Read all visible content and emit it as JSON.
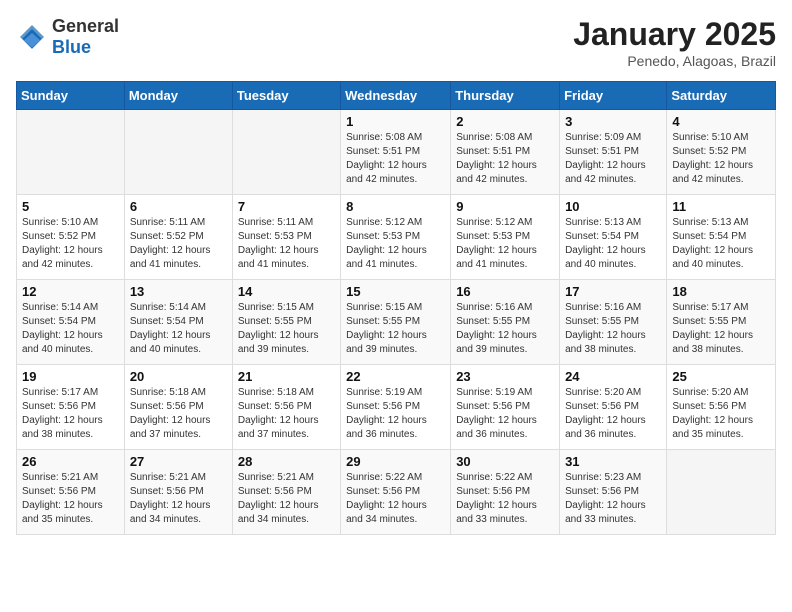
{
  "logo": {
    "general": "General",
    "blue": "Blue"
  },
  "title": "January 2025",
  "subtitle": "Penedo, Alagoas, Brazil",
  "days_of_week": [
    "Sunday",
    "Monday",
    "Tuesday",
    "Wednesday",
    "Thursday",
    "Friday",
    "Saturday"
  ],
  "weeks": [
    [
      {
        "day": "",
        "info": ""
      },
      {
        "day": "",
        "info": ""
      },
      {
        "day": "",
        "info": ""
      },
      {
        "day": "1",
        "info": "Sunrise: 5:08 AM\nSunset: 5:51 PM\nDaylight: 12 hours and 42 minutes."
      },
      {
        "day": "2",
        "info": "Sunrise: 5:08 AM\nSunset: 5:51 PM\nDaylight: 12 hours and 42 minutes."
      },
      {
        "day": "3",
        "info": "Sunrise: 5:09 AM\nSunset: 5:51 PM\nDaylight: 12 hours and 42 minutes."
      },
      {
        "day": "4",
        "info": "Sunrise: 5:10 AM\nSunset: 5:52 PM\nDaylight: 12 hours and 42 minutes."
      }
    ],
    [
      {
        "day": "5",
        "info": "Sunrise: 5:10 AM\nSunset: 5:52 PM\nDaylight: 12 hours and 42 minutes."
      },
      {
        "day": "6",
        "info": "Sunrise: 5:11 AM\nSunset: 5:52 PM\nDaylight: 12 hours and 41 minutes."
      },
      {
        "day": "7",
        "info": "Sunrise: 5:11 AM\nSunset: 5:53 PM\nDaylight: 12 hours and 41 minutes."
      },
      {
        "day": "8",
        "info": "Sunrise: 5:12 AM\nSunset: 5:53 PM\nDaylight: 12 hours and 41 minutes."
      },
      {
        "day": "9",
        "info": "Sunrise: 5:12 AM\nSunset: 5:53 PM\nDaylight: 12 hours and 41 minutes."
      },
      {
        "day": "10",
        "info": "Sunrise: 5:13 AM\nSunset: 5:54 PM\nDaylight: 12 hours and 40 minutes."
      },
      {
        "day": "11",
        "info": "Sunrise: 5:13 AM\nSunset: 5:54 PM\nDaylight: 12 hours and 40 minutes."
      }
    ],
    [
      {
        "day": "12",
        "info": "Sunrise: 5:14 AM\nSunset: 5:54 PM\nDaylight: 12 hours and 40 minutes."
      },
      {
        "day": "13",
        "info": "Sunrise: 5:14 AM\nSunset: 5:54 PM\nDaylight: 12 hours and 40 minutes."
      },
      {
        "day": "14",
        "info": "Sunrise: 5:15 AM\nSunset: 5:55 PM\nDaylight: 12 hours and 39 minutes."
      },
      {
        "day": "15",
        "info": "Sunrise: 5:15 AM\nSunset: 5:55 PM\nDaylight: 12 hours and 39 minutes."
      },
      {
        "day": "16",
        "info": "Sunrise: 5:16 AM\nSunset: 5:55 PM\nDaylight: 12 hours and 39 minutes."
      },
      {
        "day": "17",
        "info": "Sunrise: 5:16 AM\nSunset: 5:55 PM\nDaylight: 12 hours and 38 minutes."
      },
      {
        "day": "18",
        "info": "Sunrise: 5:17 AM\nSunset: 5:55 PM\nDaylight: 12 hours and 38 minutes."
      }
    ],
    [
      {
        "day": "19",
        "info": "Sunrise: 5:17 AM\nSunset: 5:56 PM\nDaylight: 12 hours and 38 minutes."
      },
      {
        "day": "20",
        "info": "Sunrise: 5:18 AM\nSunset: 5:56 PM\nDaylight: 12 hours and 37 minutes."
      },
      {
        "day": "21",
        "info": "Sunrise: 5:18 AM\nSunset: 5:56 PM\nDaylight: 12 hours and 37 minutes."
      },
      {
        "day": "22",
        "info": "Sunrise: 5:19 AM\nSunset: 5:56 PM\nDaylight: 12 hours and 36 minutes."
      },
      {
        "day": "23",
        "info": "Sunrise: 5:19 AM\nSunset: 5:56 PM\nDaylight: 12 hours and 36 minutes."
      },
      {
        "day": "24",
        "info": "Sunrise: 5:20 AM\nSunset: 5:56 PM\nDaylight: 12 hours and 36 minutes."
      },
      {
        "day": "25",
        "info": "Sunrise: 5:20 AM\nSunset: 5:56 PM\nDaylight: 12 hours and 35 minutes."
      }
    ],
    [
      {
        "day": "26",
        "info": "Sunrise: 5:21 AM\nSunset: 5:56 PM\nDaylight: 12 hours and 35 minutes."
      },
      {
        "day": "27",
        "info": "Sunrise: 5:21 AM\nSunset: 5:56 PM\nDaylight: 12 hours and 34 minutes."
      },
      {
        "day": "28",
        "info": "Sunrise: 5:21 AM\nSunset: 5:56 PM\nDaylight: 12 hours and 34 minutes."
      },
      {
        "day": "29",
        "info": "Sunrise: 5:22 AM\nSunset: 5:56 PM\nDaylight: 12 hours and 34 minutes."
      },
      {
        "day": "30",
        "info": "Sunrise: 5:22 AM\nSunset: 5:56 PM\nDaylight: 12 hours and 33 minutes."
      },
      {
        "day": "31",
        "info": "Sunrise: 5:23 AM\nSunset: 5:56 PM\nDaylight: 12 hours and 33 minutes."
      },
      {
        "day": "",
        "info": ""
      }
    ]
  ]
}
